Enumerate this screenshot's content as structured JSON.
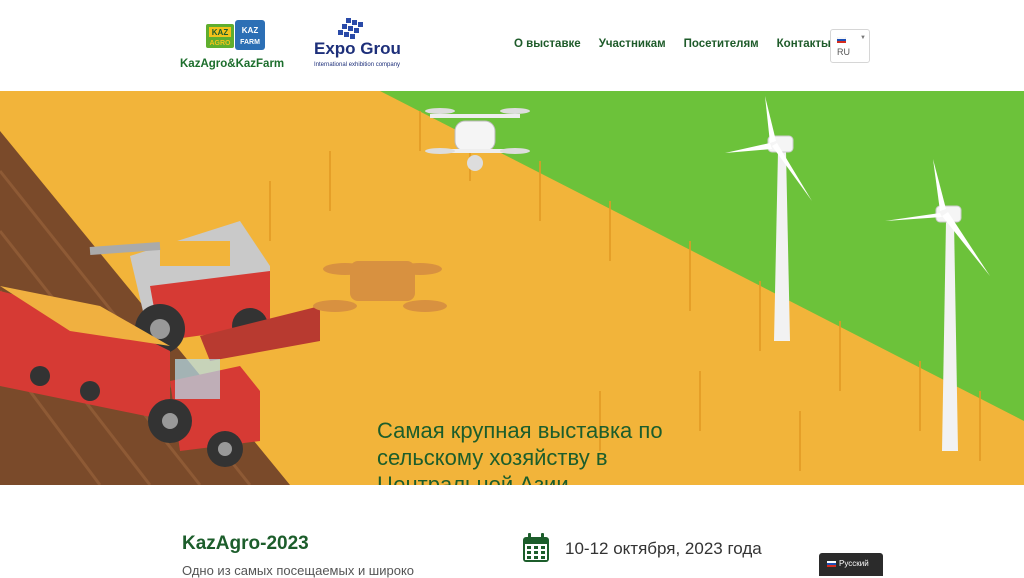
{
  "header": {
    "logo_left": "KazAgro&KazFarm",
    "logo_right_main": "Expo Group",
    "logo_right_sub": "International exhibition company",
    "nav": [
      "О выставке",
      "Участникам",
      "Посетителям",
      "Контакты"
    ],
    "lang_code": "RU"
  },
  "hero": {
    "title_line1": "Самая крупная выставка по",
    "title_line2": "сельскому хозяйству в",
    "title_line3": "Центральной Азии"
  },
  "about": {
    "title": "KazAgro-2023",
    "description": "Одно из самых посещаемых и широко",
    "date": "10-12 октября, 2023 года"
  },
  "language_widget": {
    "label": "Русский"
  },
  "colors": {
    "brand_green": "#1c5d2b",
    "field_green": "#6cc23a",
    "wheat": "#f2b43a",
    "soil": "#7a4a2a"
  }
}
